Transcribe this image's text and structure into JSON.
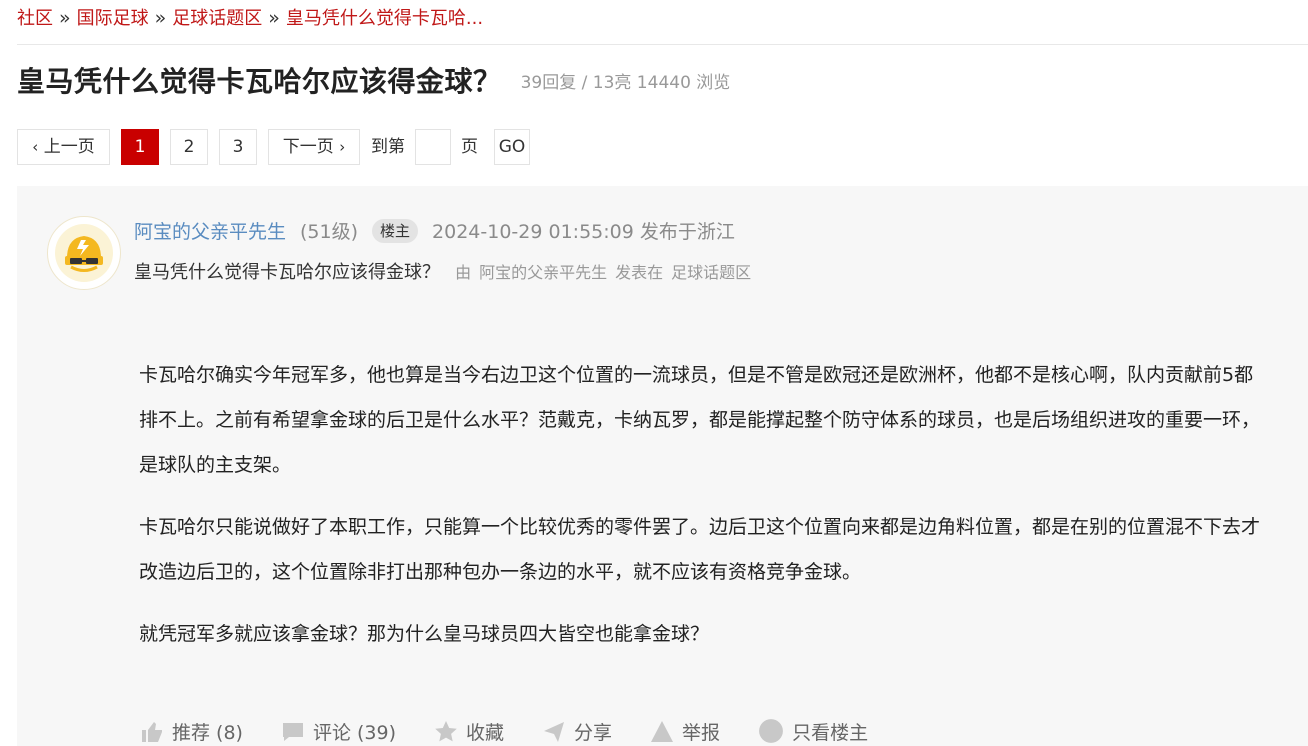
{
  "breadcrumb": {
    "items": [
      "社区",
      "国际足球",
      "足球话题区",
      "皇马凭什么觉得卡瓦哈..."
    ],
    "separator": "»"
  },
  "thread": {
    "title": "皇马凭什么觉得卡瓦哈尔应该得金球？",
    "stats": "39回复 / 13亮 14440 浏览"
  },
  "pager": {
    "prev": "上一页",
    "pages": [
      "1",
      "2",
      "3"
    ],
    "current": "1",
    "next": "下一页",
    "goto_prefix": "到第",
    "goto_suffix": "页",
    "go": "GO"
  },
  "post": {
    "username": "阿宝的父亲平先生",
    "level": "(51级)",
    "badge": "楼主",
    "time": "2024-10-29 01:55:09",
    "location": "发布于浙江",
    "title": "皇马凭什么觉得卡瓦哈尔应该得金球？",
    "sub_by": "由",
    "sub_user": "阿宝的父亲平先生",
    "sub_posted": "发表在",
    "sub_board": "足球话题区",
    "paragraphs": [
      "卡瓦哈尔确实今年冠军多，他也算是当今右边卫这个位置的一流球员，但是不管是欧冠还是欧洲杯，他都不是核心啊，队内贡献前5都排不上。之前有希望拿金球的后卫是什么水平？范戴克，卡纳瓦罗，都是能撑起整个防守体系的球员，也是后场组织进攻的重要一环，是球队的主支架。",
      "卡瓦哈尔只能说做好了本职工作，只能算一个比较优秀的零件罢了。边后卫这个位置向来都是边角料位置，都是在别的位置混不下去才改造边后卫的，这个位置除非打出那种包办一条边的水平，就不应该有资格竞争金球。",
      "就凭冠军多就应该拿金球？那为什么皇马球员四大皆空也能拿金球？"
    ]
  },
  "actions": {
    "recommend": "推荐 (8)",
    "comment": "评论 (39)",
    "favorite": "收藏",
    "share": "分享",
    "report": "举报",
    "op_only": "只看楼主"
  },
  "colors": {
    "accent": "#c90000",
    "link_red": "#c01818",
    "user_blue": "#5a8cc0"
  }
}
